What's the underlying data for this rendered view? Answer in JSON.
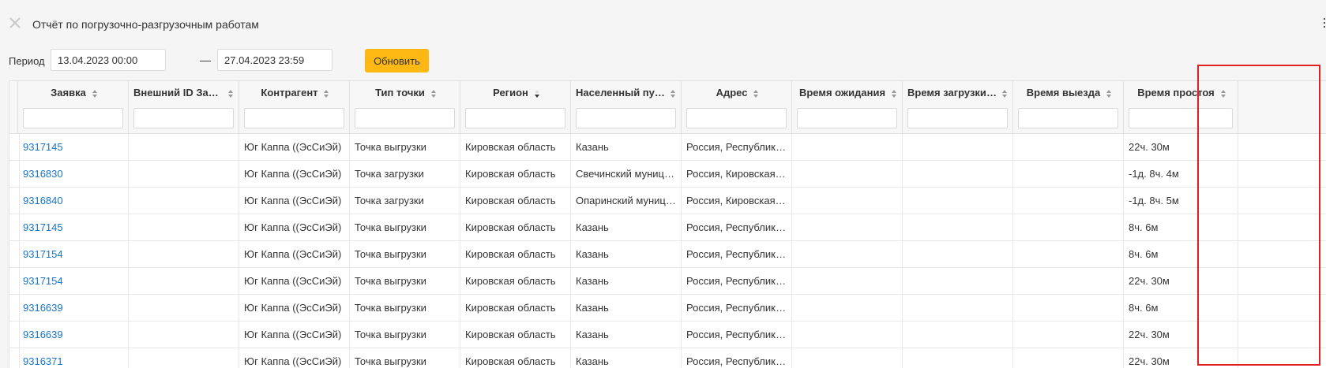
{
  "page": {
    "title": "Отчёт по погрузочно-разгрузочным работам"
  },
  "filters": {
    "period_label": "Период",
    "date_from": "13.04.2023 00:00",
    "date_to": "27.04.2023 23:59",
    "separator": "—",
    "refresh_label": "Обновить"
  },
  "table": {
    "columns": [
      {
        "key": "order",
        "label": "Заявка",
        "sort": "both"
      },
      {
        "key": "ext_id",
        "label": "Внешний ID Заявки",
        "sort": "both"
      },
      {
        "key": "counterparty",
        "label": "Контрагент",
        "sort": "both"
      },
      {
        "key": "point_type",
        "label": "Тип точки",
        "sort": "both"
      },
      {
        "key": "region",
        "label": "Регион",
        "sort": "desc"
      },
      {
        "key": "locality",
        "label": "Населенный пункт",
        "sort": "both"
      },
      {
        "key": "address",
        "label": "Адрес",
        "sort": "both"
      },
      {
        "key": "wait_time",
        "label": "Время ожидания",
        "sort": "both"
      },
      {
        "key": "load_time",
        "label": "Время загрузки/выгрузки",
        "sort": "both"
      },
      {
        "key": "depart_time",
        "label": "Время выезда",
        "sort": "both"
      },
      {
        "key": "idle_time",
        "label": "Время простоя",
        "sort": "both"
      }
    ],
    "rows": [
      [
        "9317145",
        "",
        "Юг Каппа ((ЭсСиЭй)",
        "Точка выгрузки",
        "Кировская область",
        "Казань",
        "Россия, Республика Татарстан",
        "",
        "",
        "",
        "22ч. 30м"
      ],
      [
        "9316830",
        "",
        "Юг Каппа ((ЭсСиЭй)",
        "Точка загрузки",
        "Кировская область",
        "Свечинский муниципальный округ",
        "Россия, Кировская область",
        "",
        "",
        "",
        "-1д. 8ч. 4м"
      ],
      [
        "9316840",
        "",
        "Юг Каппа ((ЭсСиЭй)",
        "Точка загрузки",
        "Кировская область",
        "Опаринский муниципальный округ",
        "Россия, Кировская область",
        "",
        "",
        "",
        "-1д. 8ч. 5м"
      ],
      [
        "9317145",
        "",
        "Юг Каппа ((ЭсСиЭй)",
        "Точка выгрузки",
        "Кировская область",
        "Казань",
        "Россия, Республика Татарстан",
        "",
        "",
        "",
        "8ч. 6м"
      ],
      [
        "9317154",
        "",
        "Юг Каппа ((ЭсСиЭй)",
        "Точка выгрузки",
        "Кировская область",
        "Казань",
        "Россия, Республика Татарстан",
        "",
        "",
        "",
        "8ч. 6м"
      ],
      [
        "9317154",
        "",
        "Юг Каппа ((ЭсСиЭй)",
        "Точка выгрузки",
        "Кировская область",
        "Казань",
        "Россия, Республика Татарстан",
        "",
        "",
        "",
        "22ч. 30м"
      ],
      [
        "9316639",
        "",
        "Юг Каппа ((ЭсСиЭй)",
        "Точка выгрузки",
        "Кировская область",
        "Казань",
        "Россия, Республика Татарстан",
        "",
        "",
        "",
        "8ч. 6м"
      ],
      [
        "9316639",
        "",
        "Юг Каппа ((ЭсСиЭй)",
        "Точка выгрузки",
        "Кировская область",
        "Казань",
        "Россия, Республика Татарстан",
        "",
        "",
        "",
        "22ч. 30м"
      ],
      [
        "9316371",
        "",
        "Юг Каппа ((ЭсСиЭй)",
        "Точка выгрузки",
        "Кировская область",
        "Казань",
        "Россия, Республика Татарстан",
        "",
        "",
        "",
        "22ч. 30м"
      ]
    ]
  },
  "colors": {
    "accent": "#fdb813",
    "link": "#1a73c8",
    "highlight": "#e02020"
  },
  "icons": {
    "close": "close-icon",
    "sort": "sort-icon"
  }
}
